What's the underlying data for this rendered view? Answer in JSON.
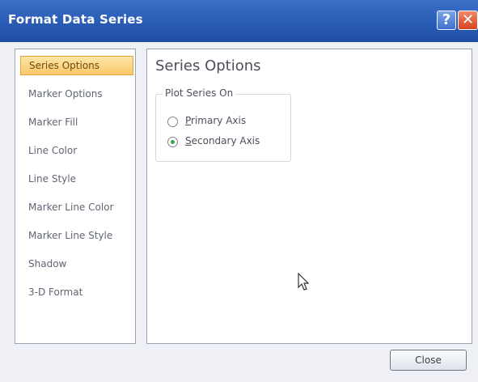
{
  "window": {
    "title": "Format Data Series",
    "help_glyph": "?",
    "close_glyph": "✕"
  },
  "nav": {
    "items": [
      {
        "label": "Series Options",
        "selected": true
      },
      {
        "label": "Marker Options",
        "selected": false
      },
      {
        "label": "Marker Fill",
        "selected": false
      },
      {
        "label": "Line Color",
        "selected": false
      },
      {
        "label": "Line Style",
        "selected": false
      },
      {
        "label": "Marker Line Color",
        "selected": false
      },
      {
        "label": "Marker Line Style",
        "selected": false
      },
      {
        "label": "Shadow",
        "selected": false
      },
      {
        "label": "3-D Format",
        "selected": false
      }
    ]
  },
  "panel": {
    "title": "Series Options",
    "group_label": "Plot Series On",
    "options": [
      {
        "label_accel": "P",
        "label_rest": "rimary Axis",
        "checked": false
      },
      {
        "label_accel": "S",
        "label_rest": "econdary Axis",
        "checked": true
      }
    ]
  },
  "footer": {
    "close_label": "Close"
  },
  "colors": {
    "titlebar": "#2d5fb8",
    "selected_item": "#f9c86a",
    "radio_checked": "#3aa646"
  }
}
